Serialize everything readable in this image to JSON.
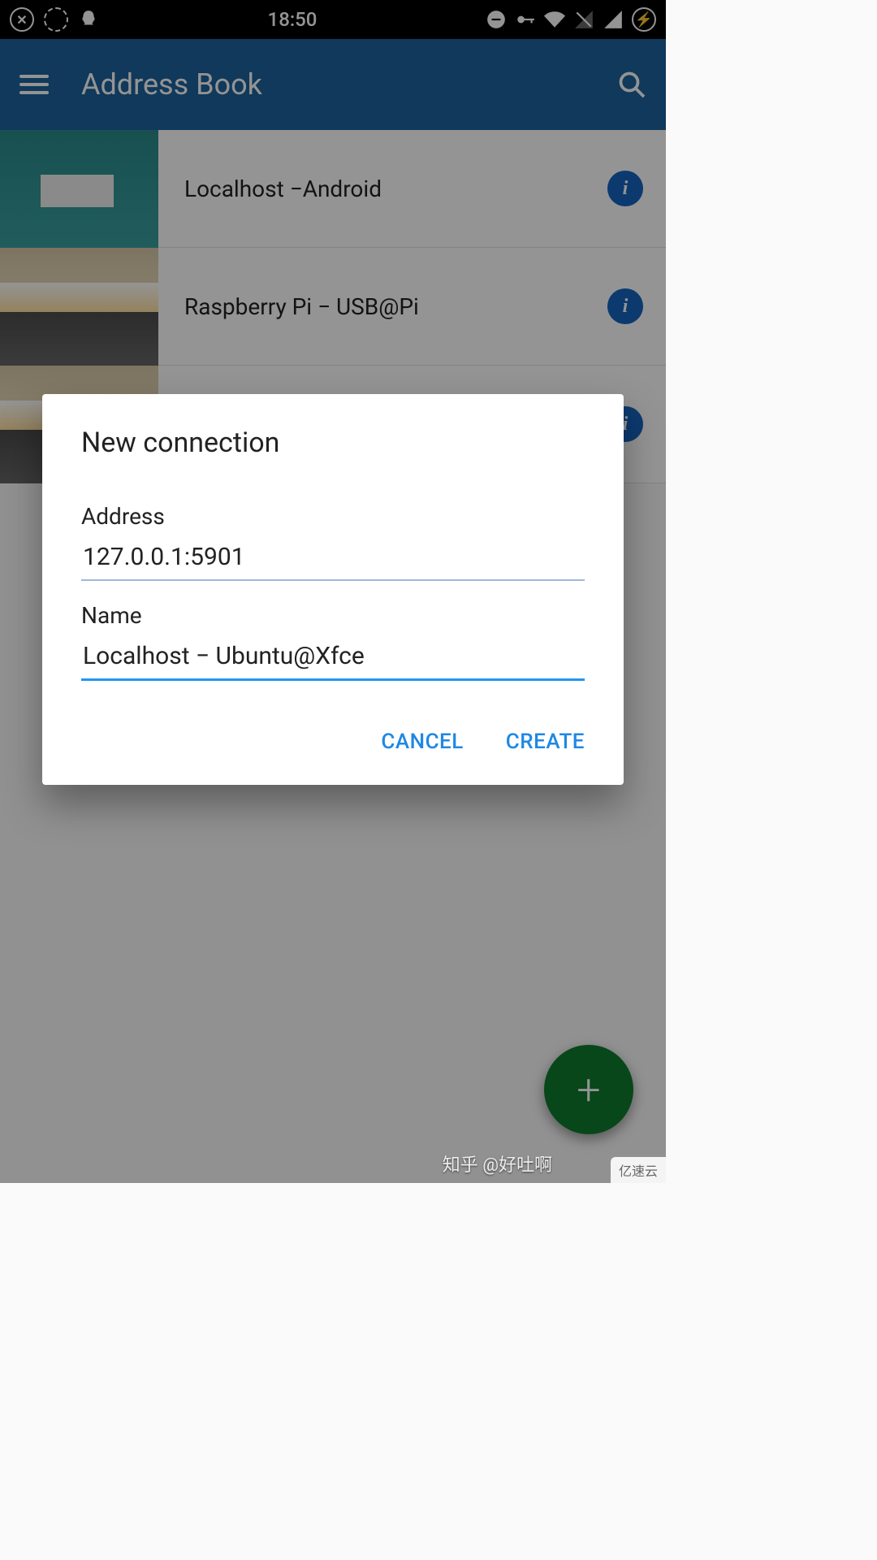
{
  "status": {
    "time": "18:50"
  },
  "app_bar": {
    "title": "Address Book"
  },
  "connections": [
    {
      "label": "Localhost −Android"
    },
    {
      "label": "Raspberry Pi − USB@Pi"
    },
    {
      "label": ""
    }
  ],
  "dialog": {
    "title": "New connection",
    "address_label": "Address",
    "address_value": "127.0.0.1:5901",
    "name_label": "Name",
    "name_value": "Localhost − Ubuntu@Xfce",
    "cancel": "CANCEL",
    "create": "CREATE"
  },
  "watermark": {
    "text": "知乎 @好吐啊",
    "corner": "亿速云"
  }
}
